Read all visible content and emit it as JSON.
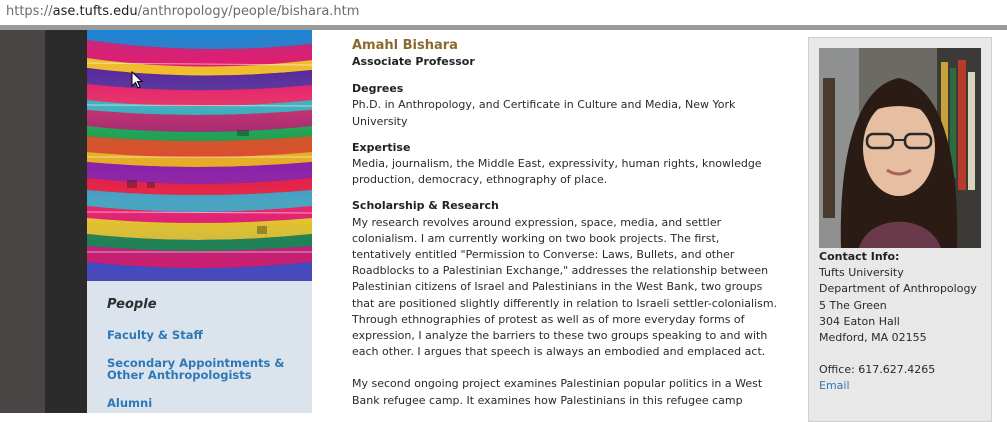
{
  "browser": {
    "url_scheme": "https://",
    "url_host": "ase.tufts.edu",
    "url_path": "/anthropology/people/bishara.htm"
  },
  "nav": {
    "title": "People",
    "links": [
      "Faculty & Staff",
      "Secondary Appointments & Other Anthropologists",
      "Alumni"
    ]
  },
  "profile": {
    "name": "Amahl Bishara",
    "rank": "Associate Professor",
    "sections": [
      {
        "heading": "Degrees",
        "text": "Ph.D. in Anthropology, and Certificate in Culture and Media, New York University"
      },
      {
        "heading": "Expertise",
        "text": "Media, journalism, the Middle East, expressivity, human rights, knowledge production, democracy, ethnography of place."
      },
      {
        "heading": "Scholarship & Research",
        "text": "My research revolves around expression, space, media, and settler colonialism. I am currently working on two book projects. The first, tentatively entitled \"Permission to Converse: Laws, Bullets, and other Roadblocks to a Palestinian Exchange,\" addresses the relationship between Palestinian citizens of Israel and Palestinians in the West Bank, two groups that are positioned slightly differently in relation to Israeli settler-colonialism. Through ethnographies of protest as well as of more everyday forms of expression, I analyze the barriers to these two groups speaking to and with each other. I argues that speech is always an embodied and emplaced act."
      }
    ],
    "paragraph2": "My second ongoing project examines Palestinian popular politics in a West Bank refugee camp. It examines how Palestinians in this refugee camp"
  },
  "contact": {
    "heading": "Contact Info:",
    "lines": [
      "Tufts University",
      "Department of Anthropology",
      "5 The Green",
      "304 Eaton Hall",
      "Medford, MA 02155"
    ],
    "office": "Office: 617.627.4265",
    "email_label": "Email"
  }
}
